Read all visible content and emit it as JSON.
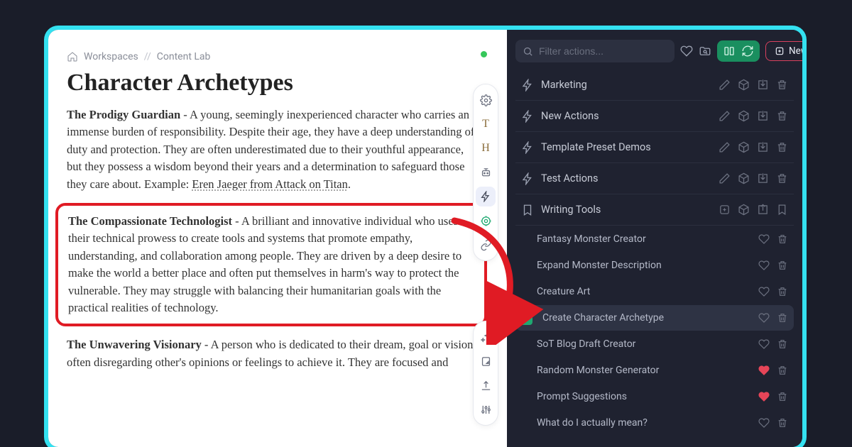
{
  "breadcrumb": {
    "workspaces": "Workspaces",
    "content_lab": "Content Lab"
  },
  "doc": {
    "title": "Character Archetypes",
    "p1_title": "The Prodigy Guardian",
    "p1_body": " - A young, seemingly inexperienced character who carries an immense burden of responsibility. Despite their age, they have a deep understanding of duty and protection. They are often underestimated due to their youthful appearance, but they possess a wisdom beyond their years and a determination to safeguard those they care about. Example: ",
    "p1_example": "Eren Jaeger from Attack on Titan",
    "p1_tail": ".",
    "p2_title": "The Compassionate Technologist",
    "p2_body": " - A brilliant and innovative individual who uses their technical prowess to create tools and systems that promote empathy, understanding, and collaboration among people. They are driven by a deep desire to make the world a better place and often put themselves in harm's way to protect the vulnerable. They may struggle with balancing their humanitarian goals with the practical realities of technology.",
    "p3_title": "The Unwavering Visionary",
    "p3_body": " - A person who is dedicated to their dream, goal or vision, often disregarding other's opinions or feelings to achieve it. They are focused and"
  },
  "search": {
    "placeholder": "Filter actions..."
  },
  "new_button": "New",
  "categories": [
    {
      "label": "Marketing"
    },
    {
      "label": "New Actions"
    },
    {
      "label": "Template Preset Demos"
    },
    {
      "label": "Test Actions"
    },
    {
      "label": "Writing Tools"
    }
  ],
  "tools": [
    {
      "label": "Fantasy Monster Creator",
      "fav": false
    },
    {
      "label": "Expand Monster Description",
      "fav": false
    },
    {
      "label": "Creature Art",
      "fav": false
    },
    {
      "label": "Create Character Archetype",
      "fav": false,
      "active": true
    },
    {
      "label": "SoT Blog Draft Creator",
      "fav": false
    },
    {
      "label": "Random Monster Generator",
      "fav": true
    },
    {
      "label": "Prompt Suggestions",
      "fav": true
    },
    {
      "label": "What do I actually mean?",
      "fav": false
    }
  ]
}
